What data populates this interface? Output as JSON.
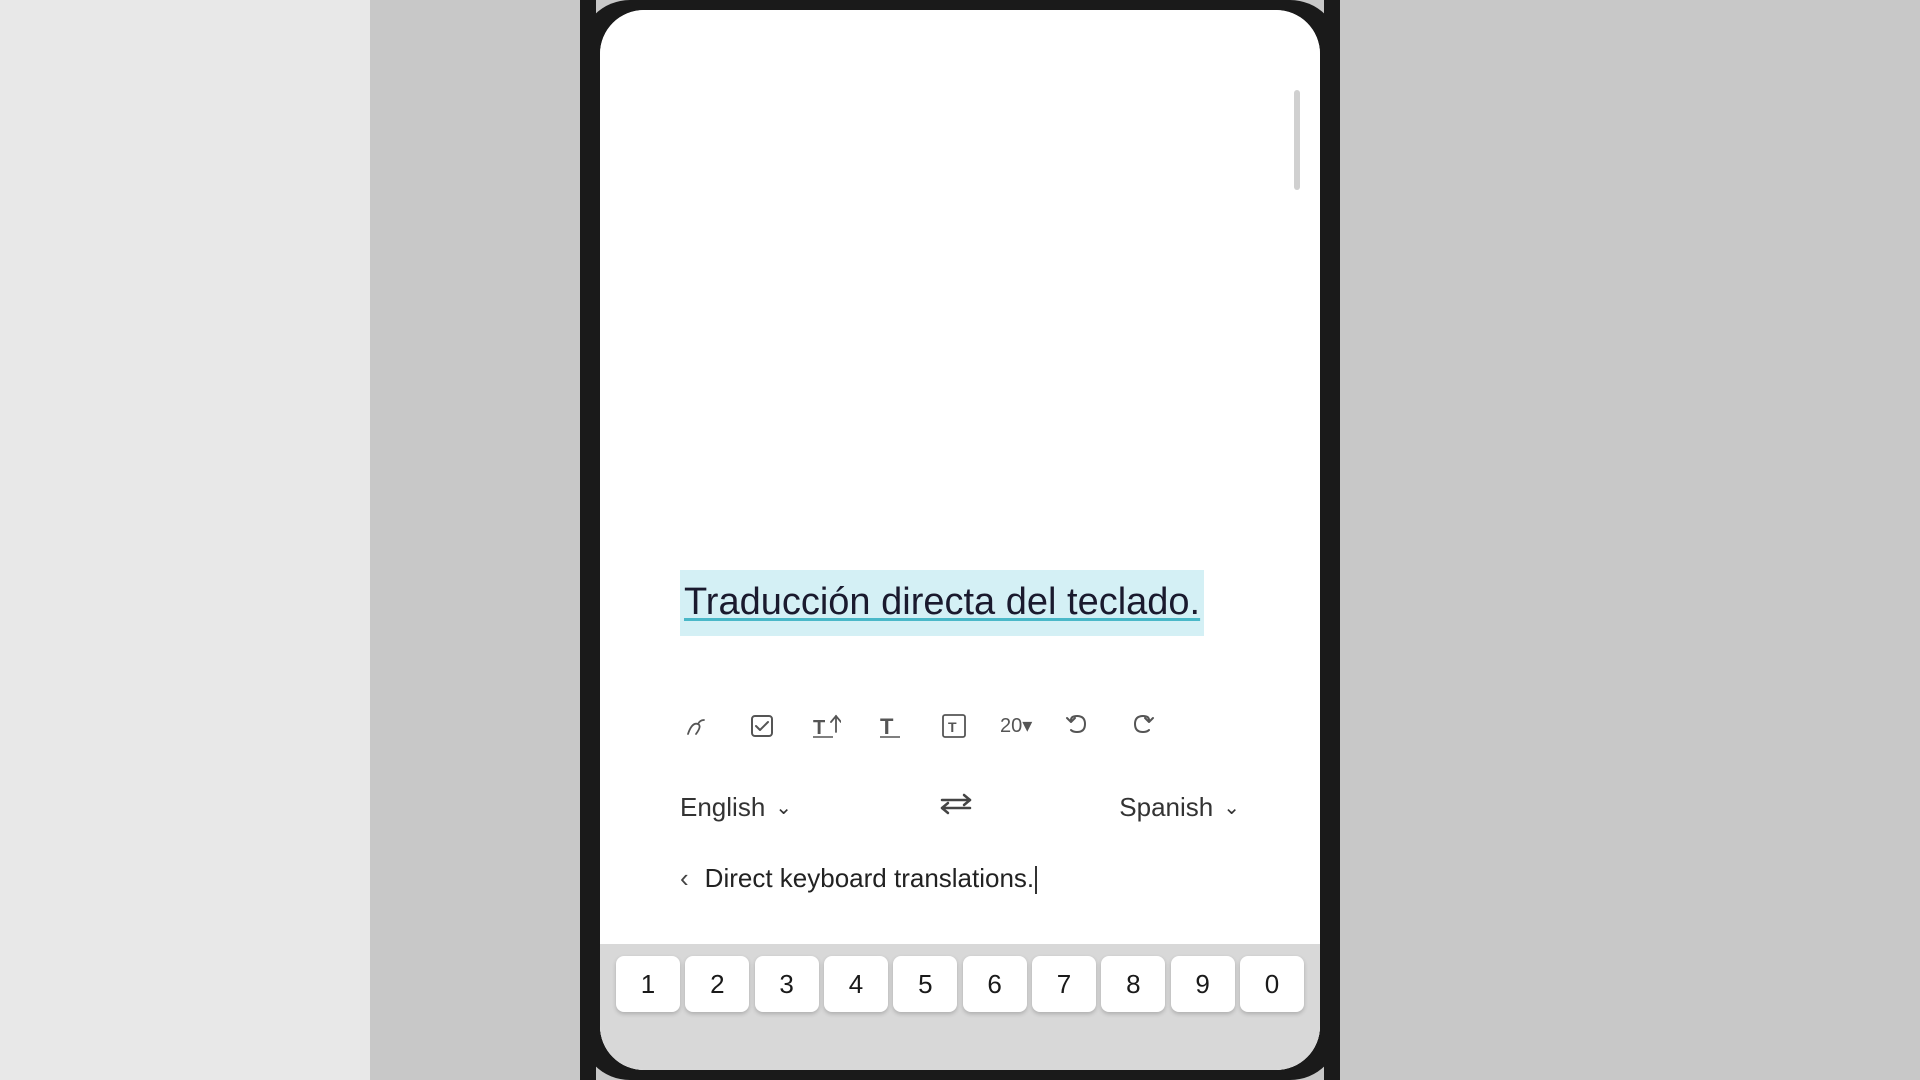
{
  "layout": {
    "background_color": "#c8c8c8"
  },
  "document": {
    "translated_text": "Traducción directa del teclado.",
    "translated_text_bg": "#ceeef4"
  },
  "toolbar": {
    "font_size": "20",
    "font_size_label": "20▾",
    "undo_label": "↩",
    "redo_label": "↪"
  },
  "translation_bar": {
    "source_lang": "English",
    "target_lang": "Spanish",
    "swap_icon": "⇄"
  },
  "input_area": {
    "back_label": "‹",
    "input_text": "Direct keyboard translations.",
    "cursor": "|"
  },
  "keyboard": {
    "number_row": [
      "1",
      "2",
      "3",
      "4",
      "5",
      "6",
      "7",
      "8",
      "9",
      "0"
    ]
  }
}
